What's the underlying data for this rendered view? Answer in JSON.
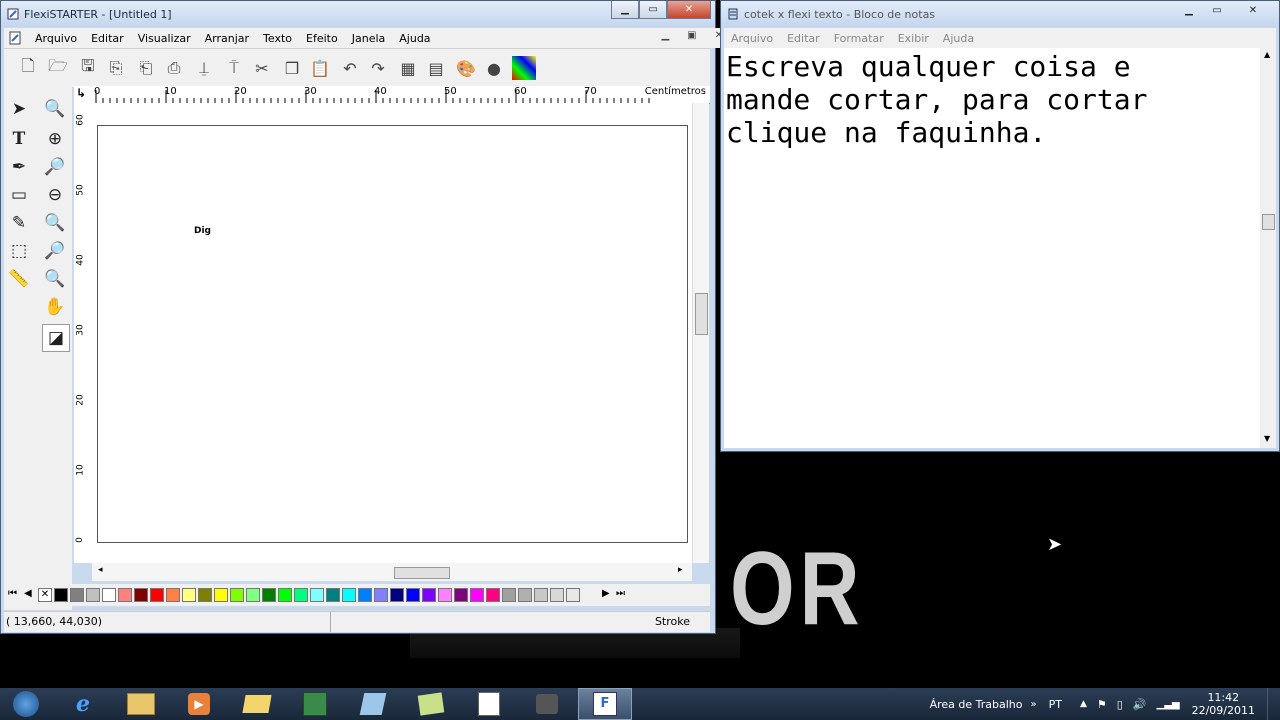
{
  "flexi": {
    "title": "FlexiSTARTER - [Untitled 1]",
    "menu": [
      "Arquivo",
      "Editar",
      "Visualizar",
      "Arranjar",
      "Texto",
      "Efeito",
      "Janela",
      "Ajuda"
    ],
    "ruler_unit": "Centímetros",
    "ruler_top_ticks": [
      "0",
      "10",
      "20",
      "30",
      "40",
      "50",
      "60",
      "70"
    ],
    "ruler_left_ticks": [
      "60",
      "50",
      "40",
      "30",
      "20",
      "10",
      "0"
    ],
    "canvas_text": "Dig",
    "status_coords": "(  13,660,     44,030)",
    "status_mode": "Stroke"
  },
  "notepad": {
    "title": "cotek x flexi texto - Bloco de notas",
    "menu": [
      "Arquivo",
      "Editar",
      "Formatar",
      "Exibir",
      "Ajuda"
    ],
    "content": "Escreva qualquer coisa e\nmande cortar, para cortar\nclique na faquinha."
  },
  "desktop": {
    "wallpaper_text": "OR"
  },
  "taskbar": {
    "desktop_label": "Área de Trabalho",
    "language": "PT",
    "time": "11:42",
    "date": "22/09/2011"
  },
  "palette_colors": [
    "#000000",
    "#808080",
    "#c0c0c0",
    "#ffffff",
    "#ff8080",
    "#800000",
    "#ff0000",
    "#ff8040",
    "#ffff80",
    "#808000",
    "#ffff00",
    "#80ff00",
    "#80ff80",
    "#008000",
    "#00ff00",
    "#00ff80",
    "#80ffff",
    "#008080",
    "#00ffff",
    "#0080ff",
    "#8080ff",
    "#000080",
    "#0000ff",
    "#8000ff",
    "#ff80ff",
    "#800080",
    "#ff00ff",
    "#ff0080",
    "#a0a0a0",
    "#b0b0b0",
    "#c8c8c8",
    "#d8d8d8",
    "#e8e8e8"
  ]
}
